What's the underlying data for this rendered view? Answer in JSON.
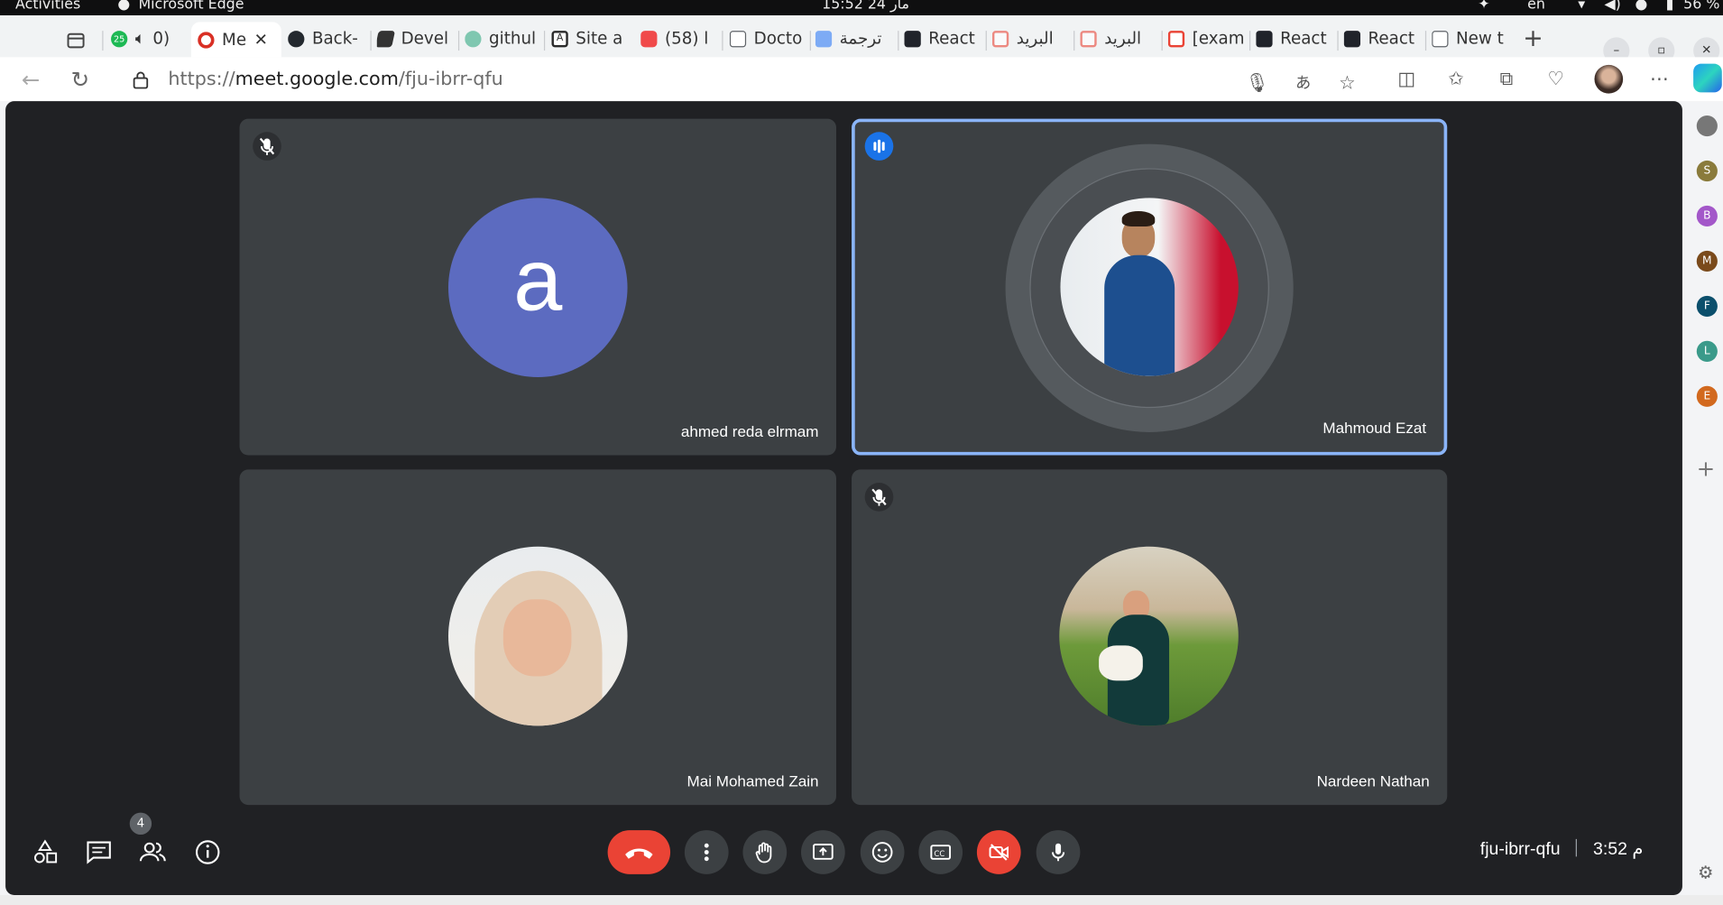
{
  "os": {
    "activities": "Activities",
    "app_name": "Microsoft Edge",
    "clock": "15:52  24 مار",
    "lang": "en",
    "battery": "56 %"
  },
  "tabs": [
    {
      "label": "0)",
      "fav": "#1db954",
      "badge": "25"
    },
    {
      "label": "Me",
      "fav": "#d93025"
    },
    {
      "label": "Back-",
      "fav": "#24292f"
    },
    {
      "label": "Devel",
      "fav": "#333"
    },
    {
      "label": "githul",
      "fav": "#7fc7b0"
    },
    {
      "label": "Site a",
      "fav": "#2b2b2b"
    },
    {
      "label": "(58) ا",
      "fav": "#f04a4a"
    },
    {
      "label": "Docto",
      "fav": "#5f6368"
    },
    {
      "label": "ترجمة",
      "fav": "#4c8bf5"
    },
    {
      "label": "React",
      "fav": "#20232a"
    },
    {
      "label": "البريد",
      "fav": "#ea4335"
    },
    {
      "label": "البريد",
      "fav": "#ea4335"
    },
    {
      "label": "[exam",
      "fav": "#ea4335"
    },
    {
      "label": "React",
      "fav": "#20232a"
    },
    {
      "label": "React",
      "fav": "#20232a"
    },
    {
      "label": "New t",
      "fav": "#5f6368"
    }
  ],
  "address": {
    "scheme": "https://",
    "host": "meet.google.com",
    "path": "/fju-ibrr-qfu"
  },
  "participants": [
    {
      "name": "ahmed reda elrmam",
      "initial": "a",
      "muted": true,
      "speaking": false,
      "avatar_color": "#5c6bc0"
    },
    {
      "name": "Mahmoud Ezat",
      "muted": false,
      "speaking": true
    },
    {
      "name": "Mai Mohamed Zain",
      "muted": false,
      "speaking": false
    },
    {
      "name": "Nardeen Nathan",
      "muted": true,
      "speaking": false
    }
  ],
  "controls": {
    "people_count": "4",
    "meeting_code": "fju-ibrr-qfu",
    "time": "3:52 م"
  },
  "edge_sidebar": [
    {
      "letter": "",
      "color": "#777"
    },
    {
      "letter": "S",
      "color": "#8a7b3c"
    },
    {
      "letter": "B",
      "color": "#a357c9"
    },
    {
      "letter": "M",
      "color": "#7a4a1b"
    },
    {
      "letter": "F",
      "color": "#0b4f6c"
    },
    {
      "letter": "L",
      "color": "#3a9a8a"
    },
    {
      "letter": "E",
      "color": "#d2691e"
    }
  ],
  "colors": {
    "meet_bg": "#202124",
    "tile_bg": "#3c4043",
    "speaking_border": "#8ab4f8",
    "hangup": "#ea4335"
  }
}
